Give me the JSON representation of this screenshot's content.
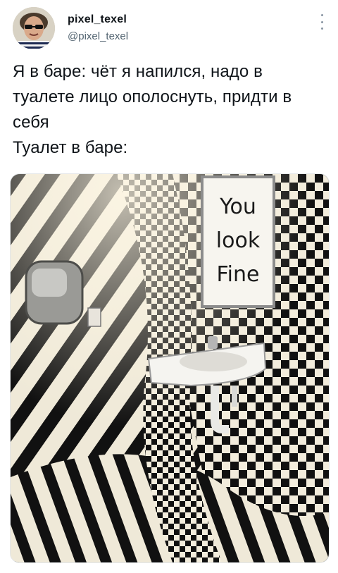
{
  "author": {
    "display_name": "pixel_texel",
    "handle": "@pixel_texel",
    "avatar_icon": "user-avatar-icon"
  },
  "menu_icon": "more-vertical-icon",
  "tweet": {
    "lines": [
      "Я в баре: чёт я напился, надо в",
      "туалете лицо ополоснуть, придти в",
      "себя",
      "Туалет в баре:"
    ]
  },
  "media": {
    "description_icon": "photo-icon",
    "mirror_text": [
      "You",
      "look",
      "Fine"
    ]
  },
  "colors": {
    "text": "#0f1419",
    "secondary": "#536471",
    "checker_dark": "#111111",
    "checker_light": "#f2ecdc"
  }
}
